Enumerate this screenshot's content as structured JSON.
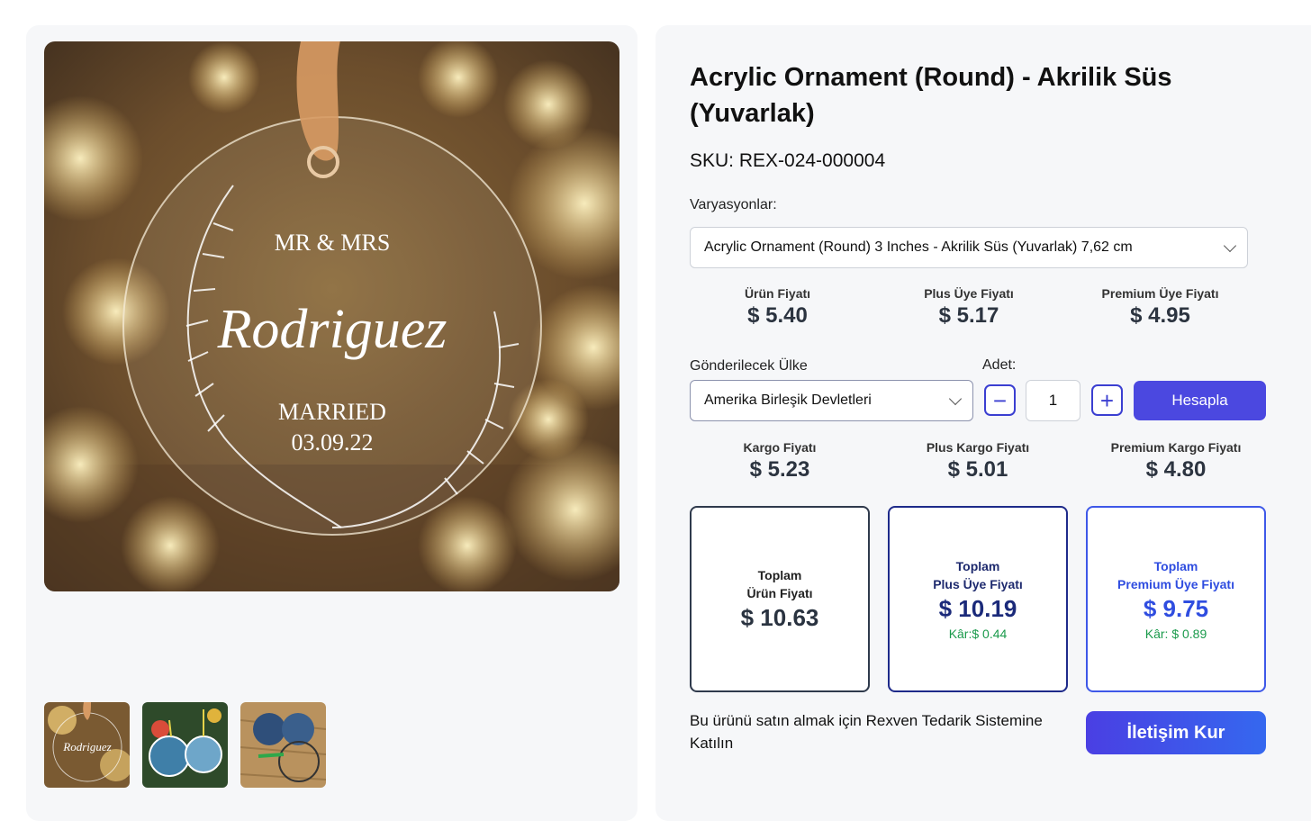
{
  "product": {
    "title": "Acrylic Ornament (Round) - Akrilik Süs (Yuvarlak)",
    "sku": "SKU: REX-024-000004",
    "image_text": {
      "line1": "MR & MRS",
      "line2": "Rodriguez",
      "line3": "MARRIED",
      "line4": "03.09.22"
    }
  },
  "variations": {
    "label": "Varyasyonlar:",
    "selected": "Acrylic Ornament (Round) 3 Inches - Akrilik Süs (Yuvarlak) 7,62 cm"
  },
  "prices": [
    {
      "label": "Ürün Fiyatı",
      "value": "$ 5.40"
    },
    {
      "label": "Plus Üye Fiyatı",
      "value": "$ 5.17"
    },
    {
      "label": "Premium Üye Fiyatı",
      "value": "$ 4.95"
    }
  ],
  "shipping_form": {
    "country_label": "Gönderilecek Ülke",
    "country_selected": "Amerika Birleşik Devletleri",
    "qty_label": "Adet:",
    "qty_value": "1",
    "calc_label": "Hesapla"
  },
  "shipping_prices": [
    {
      "label": "Kargo Fiyatı",
      "value": "$ 5.23"
    },
    {
      "label": "Plus Kargo Fiyatı",
      "value": "$ 5.01"
    },
    {
      "label": "Premium Kargo Fiyatı",
      "value": "$ 4.80"
    }
  ],
  "totals": [
    {
      "line1": "Toplam",
      "line2": "Ürün Fiyatı",
      "value": "$ 10.63",
      "profit": ""
    },
    {
      "line1": "Toplam",
      "line2": "Plus Üye Fiyatı",
      "value": "$ 10.19",
      "profit": "Kâr:$ 0.44"
    },
    {
      "line1": "Toplam",
      "line2": "Premium Üye Fiyatı",
      "value": "$ 9.75",
      "profit": "Kâr: $ 0.89"
    }
  ],
  "cta": {
    "text": "Bu ürünü satın almak için Rexven Tedarik Sistemine Katılın",
    "button": "İletişim Kur"
  },
  "colors": {
    "accent": "#4b48e0",
    "profit": "#1a9a4b",
    "premium": "#2f4de0"
  }
}
